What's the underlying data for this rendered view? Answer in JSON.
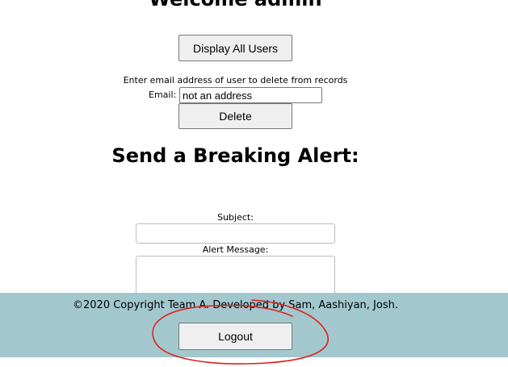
{
  "header": {
    "welcome": "Welcome admin"
  },
  "users": {
    "display_all_label": "Display All Users"
  },
  "delete_user": {
    "instructions": "Enter email address of user to delete from records",
    "email_label": "Email:",
    "email_value": "not an address",
    "delete_label": "Delete"
  },
  "alert": {
    "heading": "Send a Breaking Alert:",
    "subject_label": "Subject:",
    "message_label": "Alert Message:"
  },
  "footer": {
    "copyright": "©2020 Copyright Team A. Developed by Sam, Aashiyan, Josh.",
    "logout_label": "Logout"
  },
  "colors": {
    "footer_bg": "#a2c8ce",
    "annotation_circle": "#e0201b"
  }
}
